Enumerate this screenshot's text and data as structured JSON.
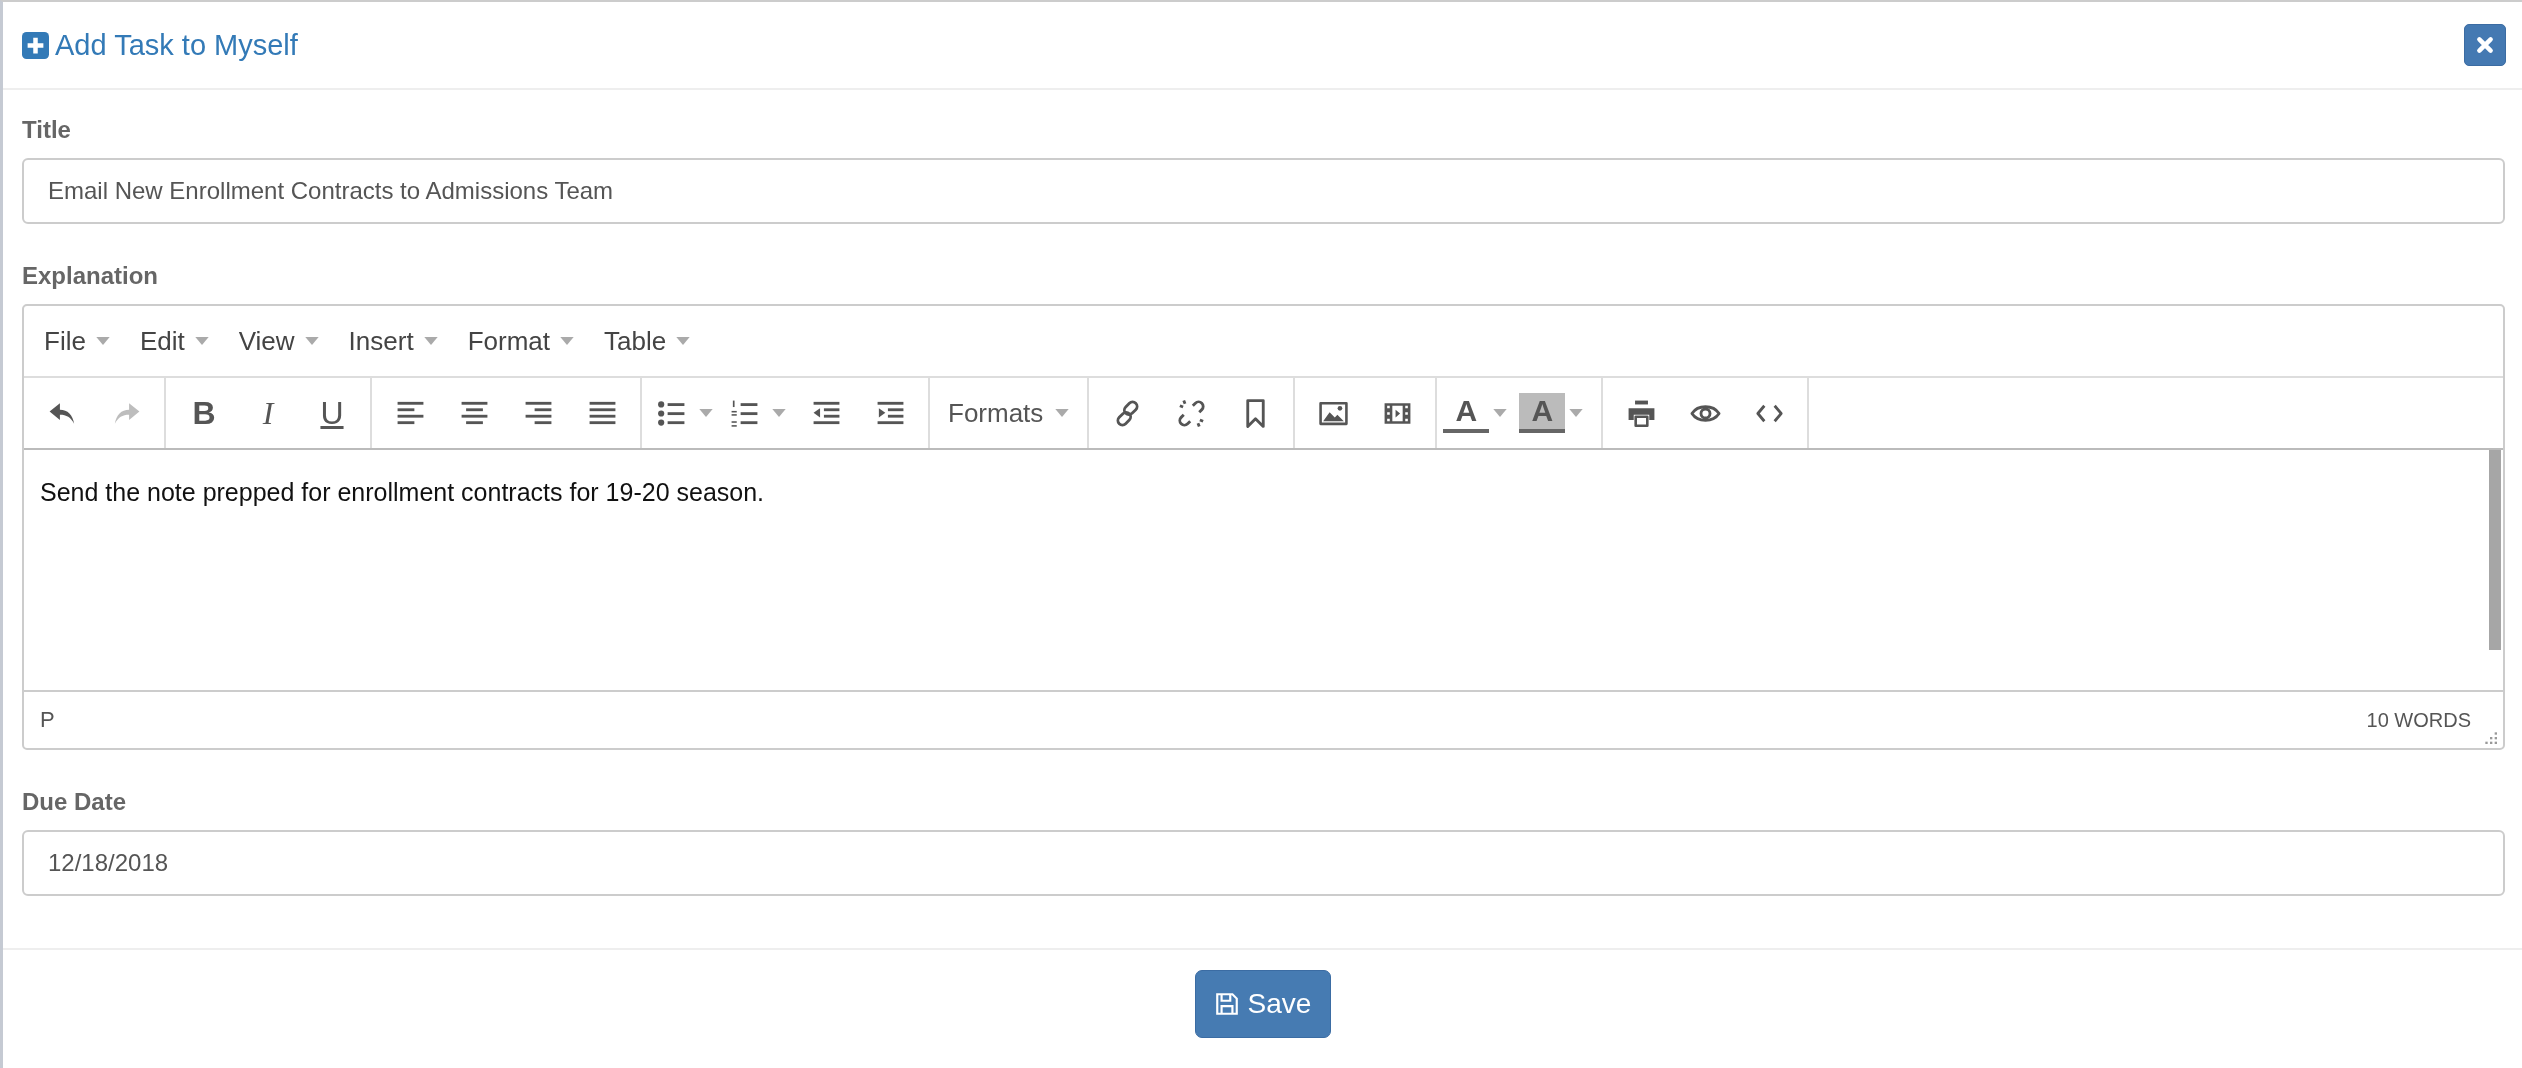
{
  "dialog": {
    "title": "Add Task to Myself"
  },
  "fields": [
    {
      "kind": "input",
      "label": "Title",
      "value": "Email New Enrollment Contracts to Admissions Team"
    },
    {
      "kind": "editor",
      "label": "Explanation"
    },
    {
      "kind": "input",
      "label": "Due Date",
      "value": "12/18/2018"
    }
  ],
  "editor": {
    "menus": [
      "File",
      "Edit",
      "View",
      "Insert",
      "Format",
      "Table"
    ],
    "toolbar": [
      {
        "items": [
          {
            "kind": "button",
            "disabled": false
          },
          {
            "kind": "button",
            "disabled": true
          }
        ]
      },
      {
        "items": [
          {
            "kind": "glyph",
            "glyph": "B"
          },
          {
            "kind": "glyph",
            "glyph": "I"
          },
          {
            "kind": "glyph",
            "glyph": "U"
          }
        ]
      },
      {
        "items": [
          {
            "kind": "button",
            "disabled": false
          },
          {
            "kind": "button",
            "disabled": false
          },
          {
            "kind": "button",
            "disabled": false
          },
          {
            "kind": "button",
            "disabled": false
          }
        ]
      },
      {
        "items": [
          {
            "kind": "split",
            "disabled": false
          },
          {
            "kind": "split",
            "disabled": false
          },
          {
            "kind": "button",
            "disabled": false
          },
          {
            "kind": "button",
            "disabled": false
          }
        ]
      },
      {
        "items": [
          {
            "kind": "dropdown",
            "label": "Formats"
          }
        ]
      },
      {
        "items": [
          {
            "kind": "button",
            "disabled": false
          },
          {
            "kind": "button",
            "disabled": false
          },
          {
            "kind": "button",
            "disabled": false
          }
        ]
      },
      {
        "items": [
          {
            "kind": "button",
            "disabled": false
          },
          {
            "kind": "button",
            "disabled": false
          }
        ]
      },
      {
        "items": [
          {
            "kind": "color",
            "glyph": "A"
          },
          {
            "kind": "color",
            "glyph": "A"
          }
        ]
      },
      {
        "items": [
          {
            "kind": "button",
            "disabled": false
          },
          {
            "kind": "button",
            "disabled": false
          },
          {
            "kind": "button",
            "disabled": false
          }
        ]
      }
    ],
    "content": "Send the note prepped for enrollment contracts for 19-20 season.",
    "path": "P",
    "word_count": "10 WORDS"
  },
  "save_button": {
    "label": "Save"
  }
}
